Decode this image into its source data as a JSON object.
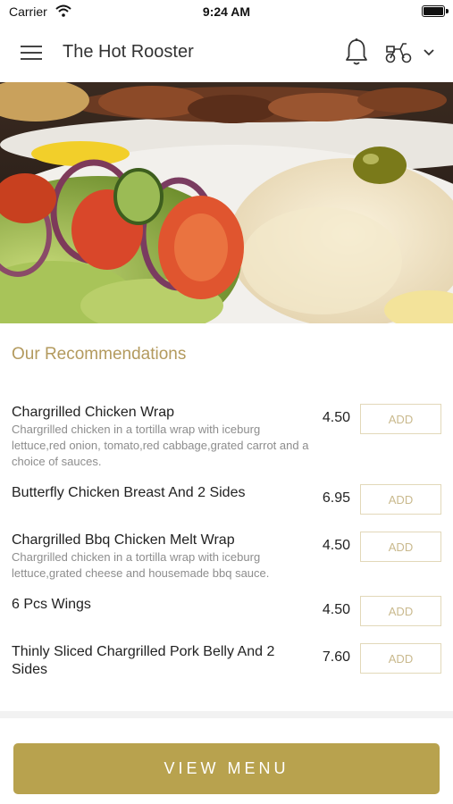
{
  "status": {
    "carrier": "Carrier",
    "time": "9:24 AM"
  },
  "header": {
    "title": "The Hot Rooster"
  },
  "recommendations": {
    "title": "Our Recommendations",
    "items": [
      {
        "name": "Chargrilled Chicken Wrap",
        "description": "Chargrilled chicken in a tortilla wrap with iceburg lettuce,red onion, tomato,red cabbage,grated carrot and a choice of sauces.",
        "price": "4.50",
        "add_label": "ADD"
      },
      {
        "name": "Butterfly Chicken Breast And 2 Sides",
        "description": "",
        "price": "6.95",
        "add_label": "ADD"
      },
      {
        "name": "Chargrilled Bbq Chicken Melt Wrap",
        "description": "Chargrilled chicken in a tortilla wrap with iceburg lettuce,grated cheese and housemade bbq sauce.",
        "price": "4.50",
        "add_label": "ADD"
      },
      {
        "name": "6 Pcs Wings",
        "description": "",
        "price": "4.50",
        "add_label": "ADD"
      },
      {
        "name": "Thinly Sliced Chargrilled Pork Belly And 2 Sides",
        "description": "",
        "price": "7.60",
        "add_label": "ADD"
      }
    ]
  },
  "footer": {
    "view_menu_label": "VIEW MENU"
  },
  "colors": {
    "accent": "#b8a24e",
    "section_title": "#b39a5e",
    "add_border": "#e2d8b9"
  },
  "icons": {
    "menu": "hamburger-icon",
    "notifications": "bell-icon",
    "delivery": "scooter-icon",
    "dropdown": "chevron-down-icon"
  }
}
